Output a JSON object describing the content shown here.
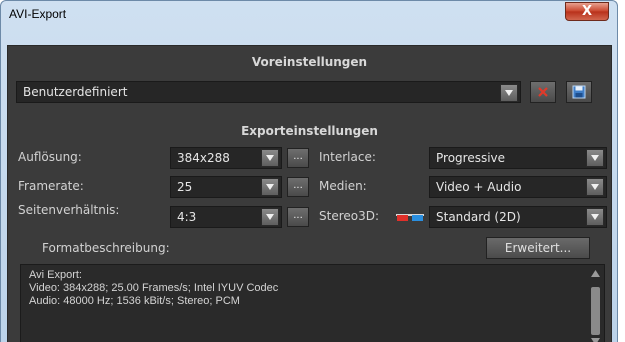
{
  "window": {
    "title": "AVI-Export",
    "close_glyph": "X"
  },
  "presets": {
    "header": "Voreinstellungen",
    "selected": "Benutzerdefiniert"
  },
  "export": {
    "header": "Exporteinstellungen",
    "resolution": {
      "label": "Auflösung:",
      "value": "384x288"
    },
    "framerate": {
      "label": "Framerate:",
      "value": "25"
    },
    "aspect": {
      "label": "Seitenverhältnis:",
      "value": "4:3"
    },
    "interlace": {
      "label": "Interlace:",
      "value": "Progressive"
    },
    "media": {
      "label": "Medien:",
      "value": "Video + Audio"
    },
    "stereo": {
      "label": "Stereo3D:",
      "value": "Standard (2D)"
    },
    "dots": "..."
  },
  "format": {
    "label": "Formatbeschreibung:",
    "advanced": "Erweitert...",
    "description": "Avi Export:\nVideo: 384x288; 25.00 Frames/s; Intel IYUV Codec\nAudio: 48000 Hz; 1536 kBit/s; Stereo; PCM"
  },
  "colors": {
    "panel": "#3b3b3b",
    "field": "#262626",
    "delete_red": "#e03a2a",
    "save_blue": "#3f7ec8"
  }
}
